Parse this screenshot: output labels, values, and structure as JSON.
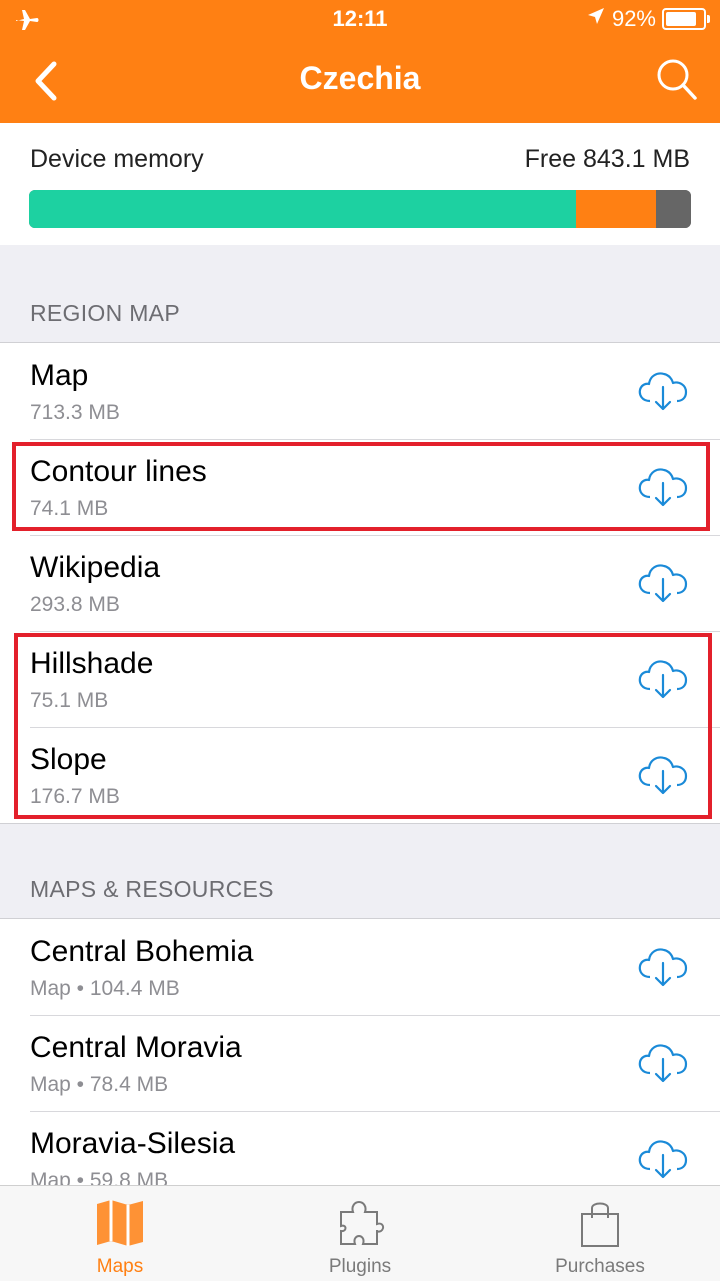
{
  "status_bar": {
    "time": "12:11",
    "battery": "92%",
    "battery_level": 0.92
  },
  "nav": {
    "title": "Czechia",
    "back_icon": "chevron-left-icon",
    "search_icon": "search-icon"
  },
  "memory": {
    "label": "Device memory",
    "free": "Free 843.1 MB",
    "usage_fractions": {
      "green": 0.826,
      "orange": 0.121,
      "gray": 0.053
    },
    "colors": {
      "green": "#1dd1a1",
      "orange": "#ff8013",
      "gray": "#666666"
    }
  },
  "region_map": {
    "header": "REGION MAP",
    "items": [
      {
        "title": "Map",
        "sub": "713.3 MB"
      },
      {
        "title": "Contour lines",
        "sub": "74.1 MB"
      },
      {
        "title": "Wikipedia",
        "sub": "293.8 MB"
      },
      {
        "title": "Hillshade",
        "sub": "75.1 MB"
      },
      {
        "title": "Slope",
        "sub": "176.7 MB"
      }
    ]
  },
  "maps_resources": {
    "header": "MAPS & RESOURCES",
    "items": [
      {
        "title": "Central Bohemia",
        "sub": "Map  •  104.4 MB"
      },
      {
        "title": "Central Moravia",
        "sub": "Map  •  78.4 MB"
      },
      {
        "title": "Moravia-Silesia",
        "sub": "Map  •  59.8 MB"
      }
    ]
  },
  "tabbar": {
    "tabs": [
      {
        "label": "Maps",
        "icon": "map-icon",
        "active": true
      },
      {
        "label": "Plugins",
        "icon": "puzzle-icon",
        "active": false
      },
      {
        "label": "Purchases",
        "icon": "shopping-bag-icon",
        "active": false
      }
    ]
  },
  "colors": {
    "accent": "#ff8013",
    "download_icon": "#1a8ad8",
    "highlight": "#e3202b"
  }
}
